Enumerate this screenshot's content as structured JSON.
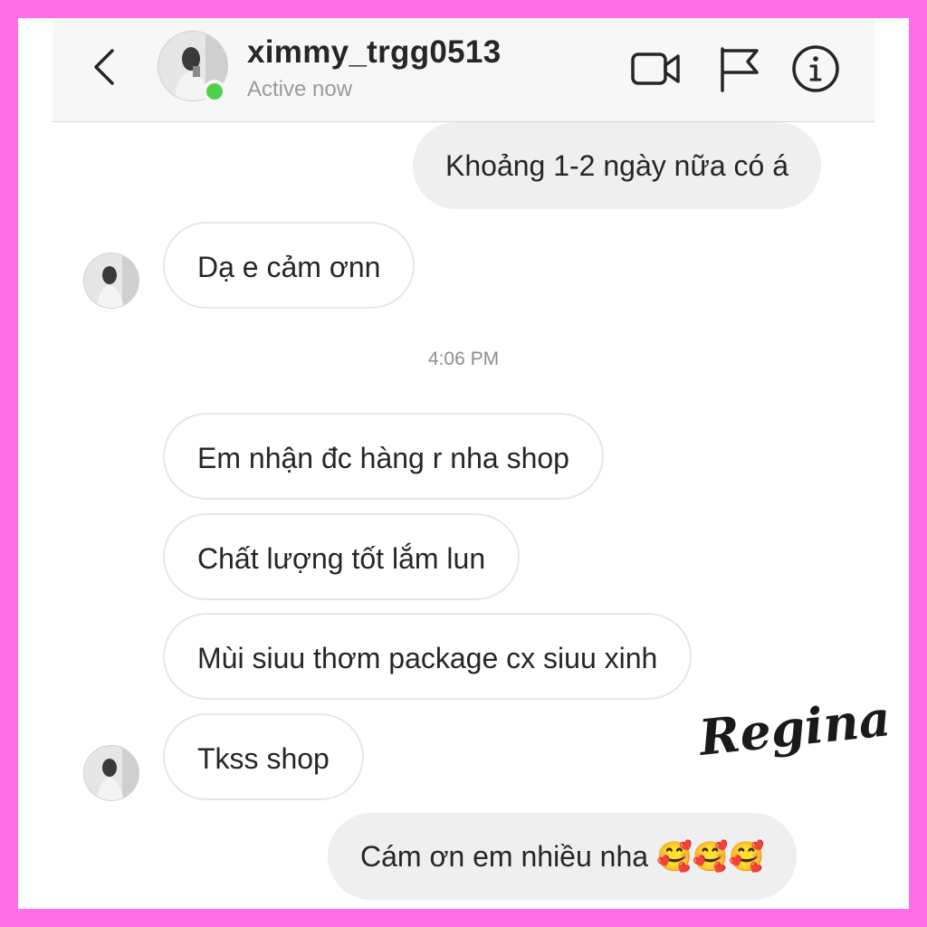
{
  "header": {
    "username": "ximmy_trgg0513",
    "status": "Active now"
  },
  "icons": {
    "back": "chevron-left-icon",
    "video": "video-camera-icon",
    "flag": "flag-icon",
    "info": "info-icon"
  },
  "messages": [
    {
      "side": "out",
      "text": "Khoảng 1-2 ngày nữa có á"
    },
    {
      "side": "in",
      "text": "Dạ e cảm ơnn"
    },
    {
      "side": "in",
      "text": "Em nhận đc hàng r nha shop"
    },
    {
      "side": "in",
      "text": "Chất lượng tốt lắm lun"
    },
    {
      "side": "in",
      "text": "Mùi siuu thơm package cx siuu xinh"
    },
    {
      "side": "in",
      "text": "Tkss shop"
    },
    {
      "side": "out",
      "text": "Cám ơn em nhiều nha 🥰🥰🥰"
    }
  ],
  "timestamp": "4:06 PM",
  "watermark": "Regina",
  "colors": {
    "border": "#ff6ee6",
    "online": "#4fd14f",
    "outgoing_bubble": "#efefef",
    "incoming_border": "#e6e6e6"
  }
}
